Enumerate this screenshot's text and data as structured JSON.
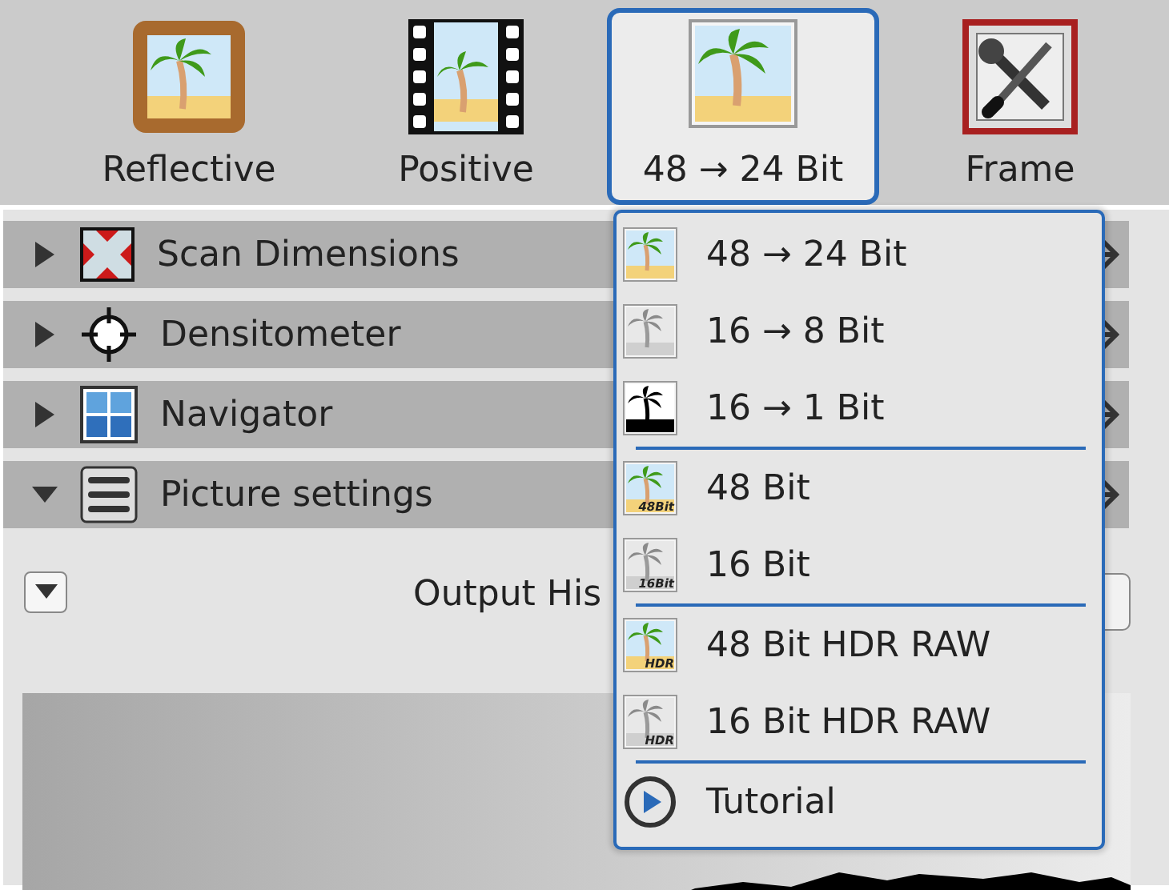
{
  "toolbar": {
    "tools": [
      {
        "label": "Reflective",
        "kind": "reflective",
        "selected": false
      },
      {
        "label": "Positive",
        "kind": "film",
        "selected": false
      },
      {
        "label": "48 → 24 Bit",
        "kind": "photo",
        "selected": true
      },
      {
        "label": "Frame",
        "kind": "tools",
        "selected": false
      }
    ]
  },
  "sections": [
    {
      "title": "Scan Dimensions",
      "kind": "dimensions",
      "expanded": false
    },
    {
      "title": "Densitometer",
      "kind": "crosshair",
      "expanded": false
    },
    {
      "title": "Navigator",
      "kind": "grid",
      "expanded": false
    },
    {
      "title": "Picture settings",
      "kind": "lines",
      "expanded": true
    }
  ],
  "picture_settings": {
    "heading": "Output His"
  },
  "menu": {
    "groups": [
      [
        {
          "label": "48 → 24 Bit",
          "kind": "color"
        },
        {
          "label": "16 → 8 Bit",
          "kind": "gray"
        },
        {
          "label": "16 → 1 Bit",
          "kind": "silhouette"
        }
      ],
      [
        {
          "label": "48 Bit",
          "kind": "color",
          "badge": "48Bit"
        },
        {
          "label": "16 Bit",
          "kind": "gray",
          "badge": "16Bit"
        }
      ],
      [
        {
          "label": "48 Bit HDR RAW",
          "kind": "color",
          "badge": "HDR"
        },
        {
          "label": "16 Bit HDR RAW",
          "kind": "gray",
          "badge": "HDR"
        }
      ],
      [
        {
          "label": "Tutorial",
          "kind": "tutorial"
        }
      ]
    ]
  }
}
